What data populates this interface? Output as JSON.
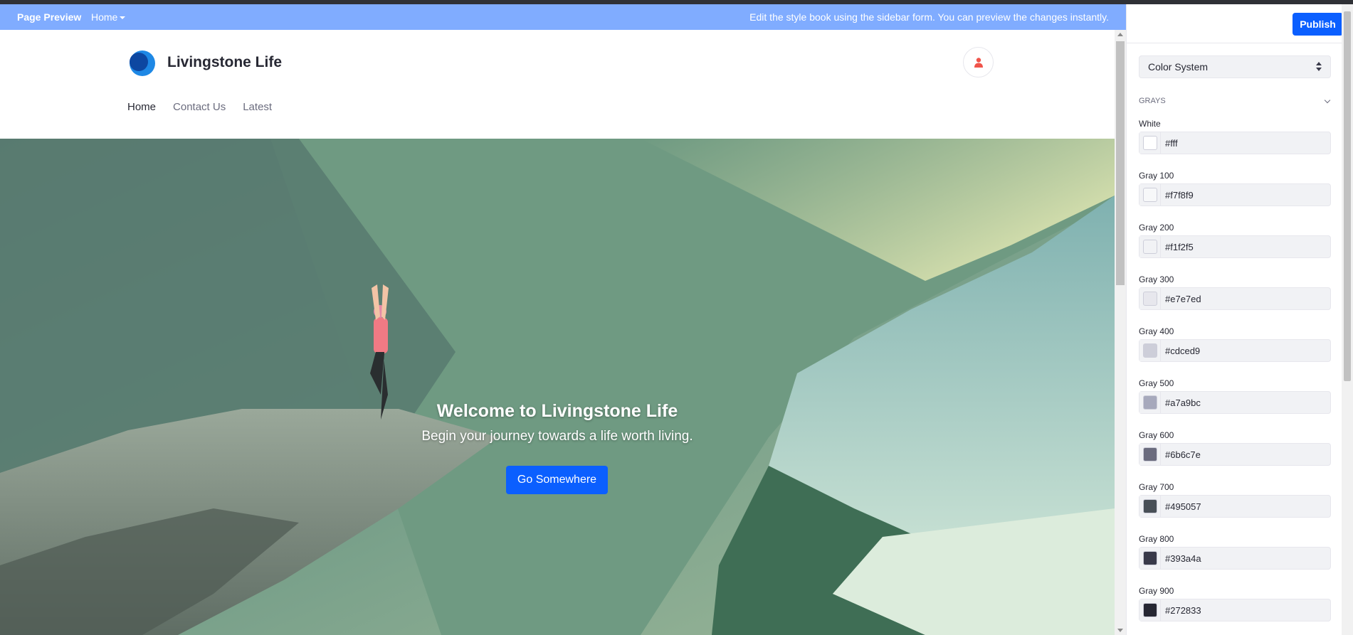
{
  "preview_bar": {
    "label": "Page Preview",
    "page_selector": "Home",
    "message": "Edit the style book using the sidebar form. You can preview the changes instantly."
  },
  "site": {
    "title": "Livingstone Life",
    "nav": [
      {
        "label": "Home",
        "active": true
      },
      {
        "label": "Contact Us",
        "active": false
      },
      {
        "label": "Latest",
        "active": false
      }
    ],
    "hero": {
      "title": "Welcome to Livingstone Life",
      "subtitle": "Begin your journey towards a life worth living.",
      "button": "Go Somewhere"
    }
  },
  "sidebar": {
    "publish": "Publish",
    "select_value": "Color System",
    "section": "Grays",
    "fields": [
      {
        "label": "White",
        "value": "#fff",
        "color": "#ffffff"
      },
      {
        "label": "Gray 100",
        "value": "#f7f8f9",
        "color": "#f7f8f9"
      },
      {
        "label": "Gray 200",
        "value": "#f1f2f5",
        "color": "#f1f2f5"
      },
      {
        "label": "Gray 300",
        "value": "#e7e7ed",
        "color": "#e7e7ed"
      },
      {
        "label": "Gray 400",
        "value": "#cdced9",
        "color": "#cdced9"
      },
      {
        "label": "Gray 500",
        "value": "#a7a9bc",
        "color": "#a7a9bc"
      },
      {
        "label": "Gray 600",
        "value": "#6b6c7e",
        "color": "#6b6c7e"
      },
      {
        "label": "Gray 700",
        "value": "#495057",
        "color": "#495057"
      },
      {
        "label": "Gray 800",
        "value": "#393a4a",
        "color": "#393a4a"
      },
      {
        "label": "Gray 900",
        "value": "#272833",
        "color": "#272833"
      }
    ]
  },
  "colors": {
    "preview_bar": "#80acff",
    "primary": "#0b5fff",
    "user_icon": "#f0544a"
  }
}
